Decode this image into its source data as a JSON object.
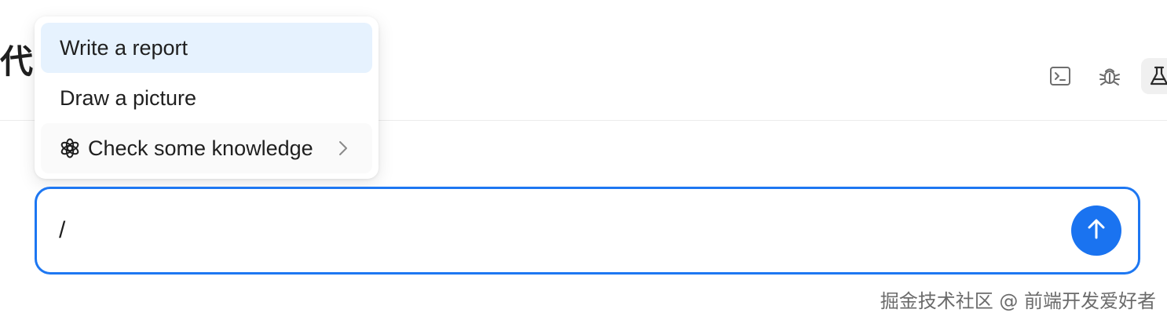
{
  "page": {
    "title": "代"
  },
  "toolbar": {
    "icons": [
      "terminal-icon",
      "bug-icon",
      "flask-icon"
    ]
  },
  "menu": {
    "items": [
      {
        "label": "Write a report",
        "active": true
      },
      {
        "label": "Draw a picture",
        "active": false
      },
      {
        "label": "Check some knowledge",
        "icon": "openai-icon",
        "has_submenu": true
      }
    ]
  },
  "composer": {
    "value": "/",
    "send_icon": "arrow-up-icon"
  },
  "watermark": {
    "text": "掘金技术社区 @ 前端开发爱好者"
  },
  "colors": {
    "accent": "#1a73f0",
    "active_item_bg": "#e6f2fe",
    "border": "#1d77f2"
  }
}
